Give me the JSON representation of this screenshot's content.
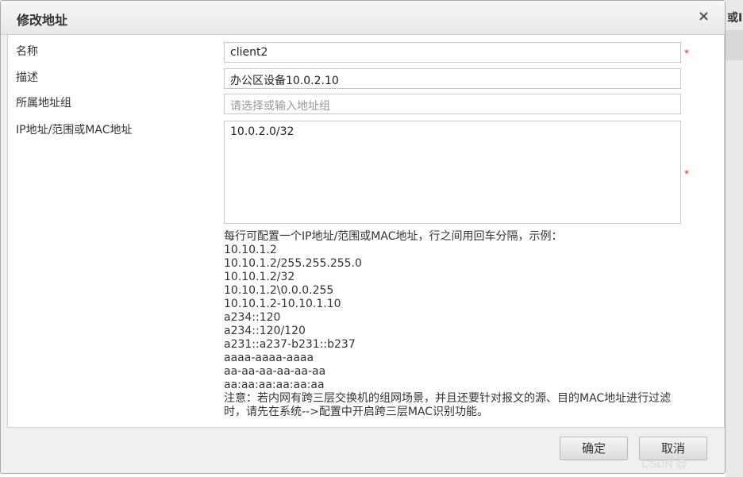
{
  "background": {
    "cut_text": "或I"
  },
  "dialog": {
    "title": "修改地址",
    "close_glyph": "×"
  },
  "form": {
    "name": {
      "label": "名称",
      "value": "client2",
      "required_mark": "*"
    },
    "description": {
      "label": "描述",
      "value": "办公区设备10.0.2.10"
    },
    "group": {
      "label": "所属地址组",
      "placeholder": "请选择或输入地址组"
    },
    "ip": {
      "label": "IP地址/范围或MAC地址",
      "value": "10.0.2.0/32",
      "required_mark": "*"
    }
  },
  "help": {
    "intro": "每行可配置一个IP地址/范围或MAC地址，行之间用回车分隔，示例：",
    "examples": [
      "10.10.1.2",
      "10.10.1.2/255.255.255.0",
      "10.10.1.2/32",
      "10.10.1.2\\0.0.0.255",
      "10.10.1.2-10.10.1.10",
      "a234::120",
      "a234::120/120",
      "a231::a237-b231::b237",
      "aaaa-aaaa-aaaa",
      "aa-aa-aa-aa-aa-aa",
      "aa:aa:aa:aa:aa:aa"
    ],
    "note": "注意：若内网有跨三层交换机的组网场景，并且还要针对报文的源、目的MAC地址进行过滤时，请先在系统-->配置中开启跨三层MAC识别功能。"
  },
  "buttons": {
    "ok": "确定",
    "cancel": "取消"
  },
  "watermark": "CSDN @"
}
